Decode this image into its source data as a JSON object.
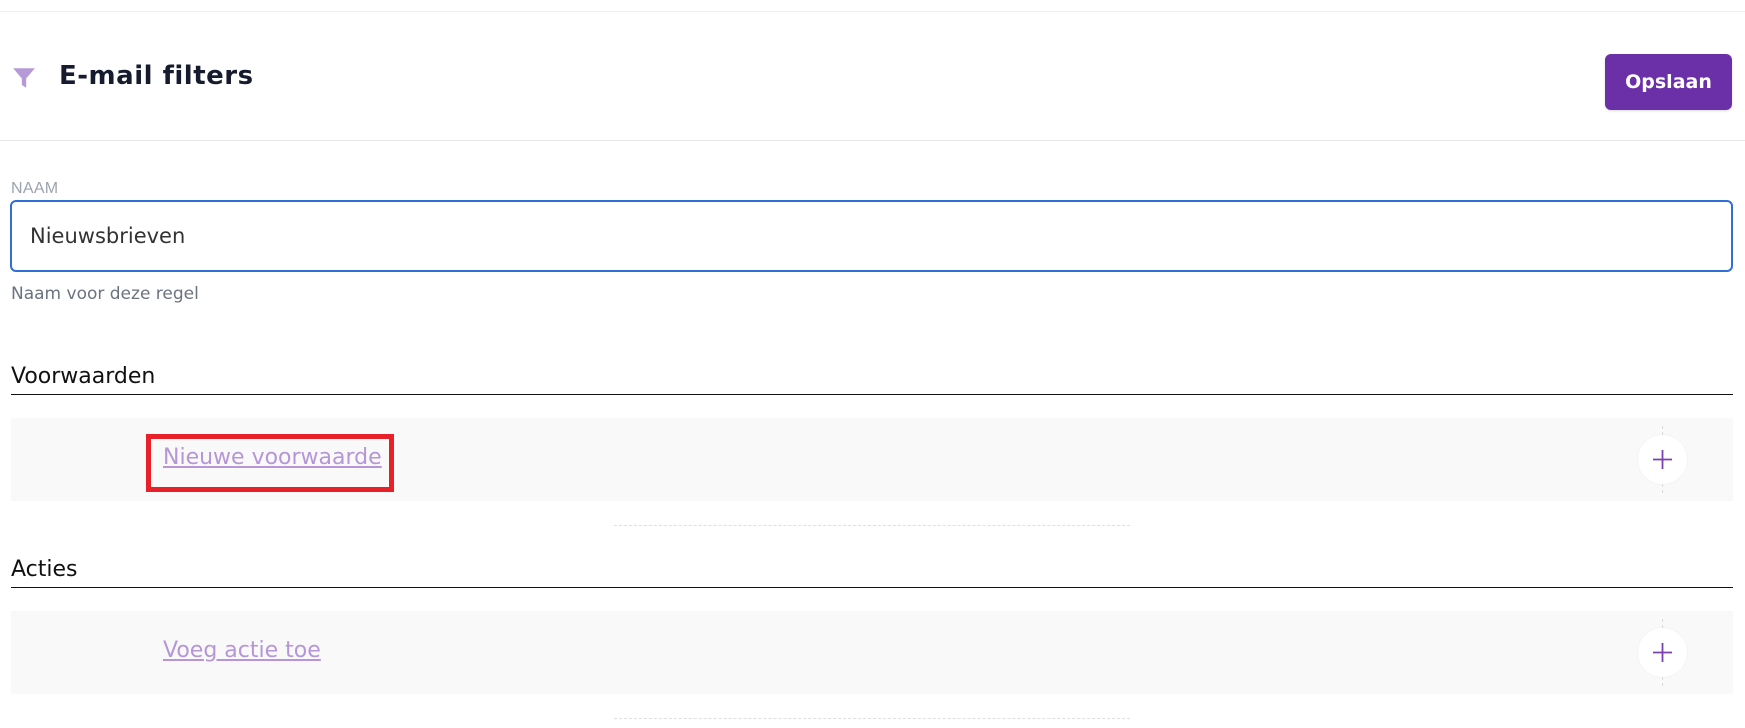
{
  "header": {
    "title": "E-mail filters",
    "save_label": "Opslaan",
    "icon": "filter-icon"
  },
  "name_field": {
    "label": "NAAM",
    "value": "Nieuwsbrieven",
    "help": "Naam voor deze regel"
  },
  "conditions": {
    "title": "Voorwaarden",
    "add_link": "Nieuwe voorwaarde",
    "add_icon": "plus-icon"
  },
  "actions": {
    "title": "Acties",
    "add_link": "Voeg actie toe",
    "add_icon": "plus-icon"
  },
  "colors": {
    "accent": "#6b2fa8",
    "link": "#b596d6",
    "focus": "#2f6fd6",
    "highlight": "#e8202a"
  }
}
